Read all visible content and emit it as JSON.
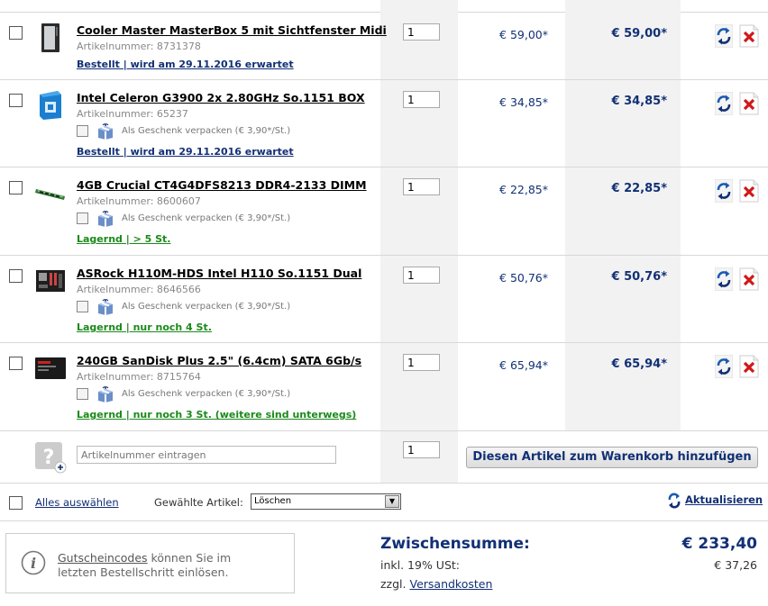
{
  "items": [
    {
      "name": "Cooler Master MasterBox 5 mit Sichtfenster Midi",
      "article_label": "Artikelnummer: 8731378",
      "gift": null,
      "stock": "Bestellt | wird am 29.11.2016 erwartet",
      "stock_type": "blue",
      "qty": "1",
      "price": "€ 59,00*",
      "total": "€ 59,00*",
      "thumb": "case"
    },
    {
      "name": "Intel Celeron G3900 2x 2.80GHz So.1151 BOX",
      "article_label": "Artikelnummer: 65237",
      "gift": "Als Geschenk verpacken (€ 3,90*/St.)",
      "stock": "Bestellt | wird am 29.11.2016 erwartet",
      "stock_type": "blue",
      "qty": "1",
      "price": "€ 34,85*",
      "total": "€ 34,85*",
      "thumb": "cpu"
    },
    {
      "name": "4GB Crucial CT4G4DFS8213 DDR4-2133 DIMM",
      "article_label": "Artikelnummer: 8600607",
      "gift": "Als Geschenk verpacken (€ 3,90*/St.)",
      "stock": "Lagernd | > 5 St.",
      "stock_type": "green",
      "qty": "1",
      "price": "€ 22,85*",
      "total": "€ 22,85*",
      "thumb": "ram"
    },
    {
      "name": "ASRock H110M-HDS Intel H110 So.1151 Dual",
      "article_label": "Artikelnummer: 8646566",
      "gift": "Als Geschenk verpacken (€ 3,90*/St.)",
      "stock": "Lagernd | nur noch 4 St.",
      "stock_type": "green",
      "qty": "1",
      "price": "€ 50,76*",
      "total": "€ 50,76*",
      "thumb": "mainboard"
    },
    {
      "name": "240GB SanDisk Plus 2.5\" (6.4cm) SATA 6Gb/s",
      "article_label": "Artikelnummer: 8715764",
      "gift": "Als Geschenk verpacken (€ 3,90*/St.)",
      "stock": "Lagernd | nur noch 3 St. (weitere sind unterwegs)",
      "stock_type": "green",
      "qty": "1",
      "price": "€ 65,94*",
      "total": "€ 65,94*",
      "thumb": "ssd"
    }
  ],
  "add_item": {
    "placeholder": "Artikelnummer eintragen",
    "qty": "1",
    "button_label": "Diesen Artikel zum Warenkorb hinzufügen"
  },
  "selection": {
    "select_all": "Alles auswählen",
    "selected_label": "Gewählte Artikel:",
    "action_value": "Löschen",
    "update_label": "Aktualisieren"
  },
  "voucher": {
    "link": "Gutscheincodes",
    "line1_rest": " können Sie im",
    "line2": "letzten Bestellschritt einlösen."
  },
  "summary": {
    "subtotal_label": "Zwischensumme:",
    "subtotal_value": "€ 233,40",
    "tax_label": "inkl. 19% USt:",
    "tax_value": "€ 37,26",
    "shipping_prefix": "zzgl. ",
    "shipping_link": "Versandkosten"
  },
  "colors": {
    "brand_blue": "#123075",
    "stock_green": "#1a8a1a",
    "column_gray": "#f2f2f2",
    "delete_red": "#d11818"
  }
}
